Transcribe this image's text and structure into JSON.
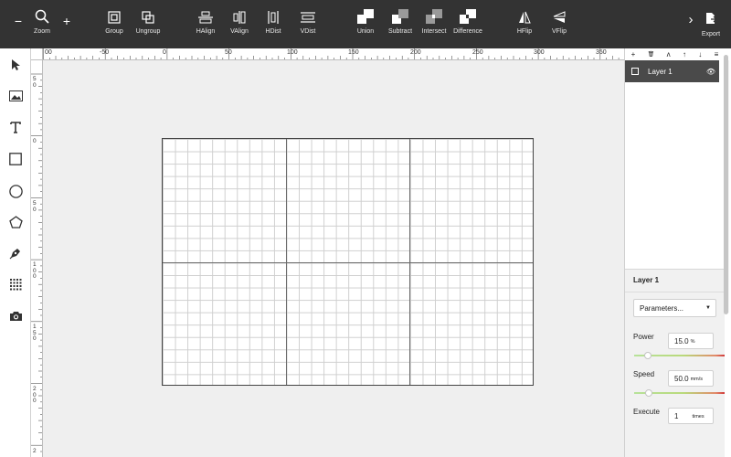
{
  "toolbar": {
    "zoom_minus": "−",
    "zoom_plus": "+",
    "zoom_label": "Zoom",
    "group_label": "Group",
    "ungroup_label": "Ungroup",
    "halign_label": "HAlign",
    "valign_label": "VAlign",
    "hdist_label": "HDist",
    "vdist_label": "VDist",
    "union_label": "Union",
    "subtract_label": "Subtract",
    "intersect_label": "Intersect",
    "difference_label": "Difference",
    "hflip_label": "HFlip",
    "vflip_label": "VFlip",
    "more_glyph": "›",
    "export_label": "Export"
  },
  "ruler": {
    "top_labels": [
      "00",
      "-50",
      "0",
      "50",
      "100",
      "150",
      "200",
      "250",
      "300",
      "350"
    ],
    "left_labels": [
      "50",
      "0",
      "50",
      "100",
      "150",
      "200",
      "2"
    ]
  },
  "tools": [
    "select-icon",
    "image-icon",
    "text-icon",
    "rectangle-icon",
    "ellipse-icon",
    "polygon-icon",
    "pen-icon",
    "grid-array-icon",
    "camera-icon"
  ],
  "layers_toolbar": [
    "+",
    "🗑",
    "ᴧ",
    "↑",
    "↓",
    "≡"
  ],
  "layers": [
    {
      "name": "Layer 1",
      "eye": "👁"
    }
  ],
  "properties": {
    "title": "Layer 1",
    "mode_select": "Parameters...",
    "power_label": "Power",
    "power_value": "15.0",
    "power_unit": "%",
    "power_level": 0.15,
    "speed_label": "Speed",
    "speed_value": "50.0",
    "speed_unit": "mm/s",
    "speed_level": 0.16,
    "execute_label": "Execute",
    "execute_value": "1",
    "execute_unit": "times"
  },
  "colors": {
    "toolbar_bg": "#333333",
    "layer_selected_bg": "#4a4a4a",
    "grid_line": "#cfcfcf",
    "grid_major": "#6b6b6b"
  }
}
